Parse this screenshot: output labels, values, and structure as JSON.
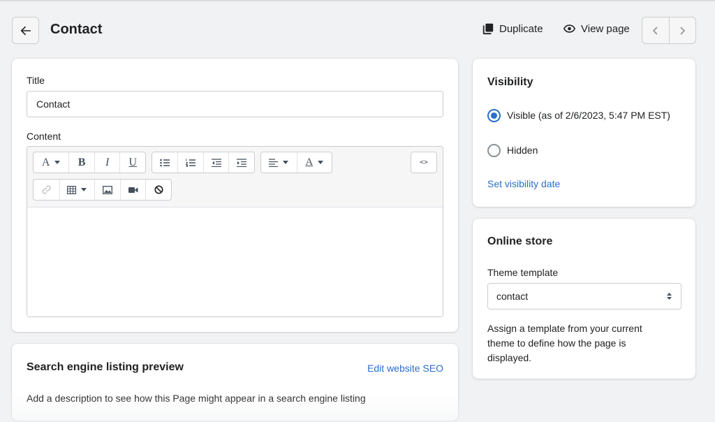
{
  "header": {
    "title": "Contact",
    "duplicate_label": "Duplicate",
    "view_page_label": "View page"
  },
  "main_card": {
    "title_label": "Title",
    "title_value": "Contact",
    "content_label": "Content",
    "editor_body": ""
  },
  "editor_toolbar": {
    "font_glyph": "A",
    "bold_glyph": "B",
    "italic_glyph": "I",
    "underline_glyph": "U",
    "text_color_glyph": "A",
    "html_glyph": "<>"
  },
  "seo_card": {
    "heading": "Search engine listing preview",
    "edit_link": "Edit website SEO",
    "description": "Add a description to see how this Page might appear in a search engine listing"
  },
  "visibility_card": {
    "heading": "Visibility",
    "options": [
      {
        "label": "Visible (as of 2/6/2023, 5:47 PM EST)",
        "checked": true
      },
      {
        "label": "Hidden",
        "checked": false
      }
    ],
    "set_date_link": "Set visibility date"
  },
  "online_store_card": {
    "heading": "Online store",
    "template_label": "Theme template",
    "template_value": "contact",
    "help_text": "Assign a template from your current theme to define how the page is displayed."
  },
  "colors": {
    "accent": "#2c6ecb",
    "background": "#f1f2f3",
    "text": "#202223"
  }
}
